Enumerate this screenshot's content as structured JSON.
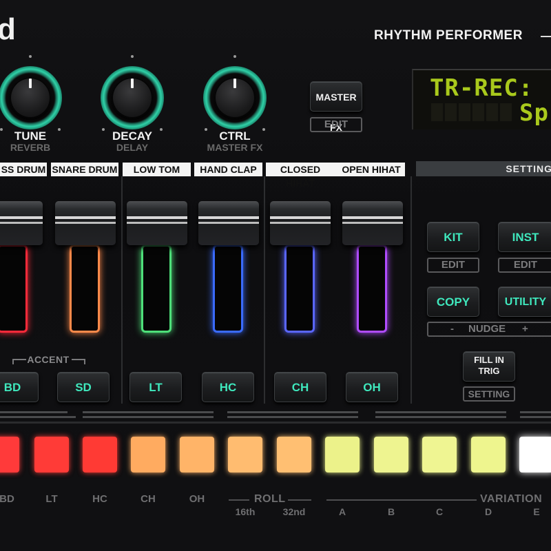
{
  "brand": {
    "logo_text": "d",
    "model": "RHYTHM PERFORMER"
  },
  "knobs": [
    {
      "label": "TUNE",
      "sub": "REVERB"
    },
    {
      "label": "DECAY",
      "sub": "DELAY"
    },
    {
      "label": "CTRL",
      "sub": "MASTER FX"
    }
  ],
  "master_fx": {
    "button": "MASTER FX",
    "edit": "EDIT"
  },
  "display": {
    "line1": "TR-REC:",
    "line2": "Sp"
  },
  "settings_bar": "SETTING",
  "instruments": [
    "SS DRUM",
    "SNARE DRUM",
    "LOW TOM",
    "HAND CLAP",
    "CLOSED HIHAT",
    "OPEN HIHAT"
  ],
  "faders": [
    {
      "name": "bass-drum",
      "color": "#ff2a3a"
    },
    {
      "name": "snare-drum",
      "color": "#ff8a4a"
    },
    {
      "name": "low-tom",
      "color": "#4ee07a"
    },
    {
      "name": "hand-clap",
      "color": "#3a6bff"
    },
    {
      "name": "closed-hihat",
      "color": "#5a66ff"
    },
    {
      "name": "open-hihat",
      "color": "#b04cff"
    }
  ],
  "accent_label": "ACCENT",
  "inst_buttons": [
    "BD",
    "SD",
    "LT",
    "HC",
    "CH",
    "OH"
  ],
  "right_buttons": {
    "kit": "KIT",
    "kit_edit": "EDIT",
    "inst": "INST",
    "inst_edit": "EDIT",
    "copy": "COPY",
    "utility": "UTILITY",
    "nudge_minus": "-",
    "nudge": "NUDGE",
    "nudge_plus": "+",
    "fill_in_trig_1": "FILL IN",
    "fill_in_trig_2": "TRIG",
    "setting": "SETTING"
  },
  "pads": [
    {
      "color": "#ff3a3a",
      "label": "BD"
    },
    {
      "color": "#ff3b37",
      "label": "LT"
    },
    {
      "color": "#ff3a34",
      "label": "HC"
    },
    {
      "color": "#ffab60",
      "label": "CH"
    },
    {
      "color": "#ffb468",
      "label": "OH"
    },
    {
      "color": "#ffbc70",
      "label": "",
      "sub": "16th"
    },
    {
      "color": "#ffbf72",
      "label": "",
      "sub": "32nd"
    },
    {
      "color": "#ecf28a",
      "label": "A"
    },
    {
      "color": "#eef490",
      "label": "B"
    },
    {
      "color": "#eff592",
      "label": "C"
    },
    {
      "color": "#eef58e",
      "label": "D"
    },
    {
      "color": "#ffffff",
      "label": "E"
    }
  ],
  "roll_label": "ROLL",
  "variation_label": "VARIATION"
}
